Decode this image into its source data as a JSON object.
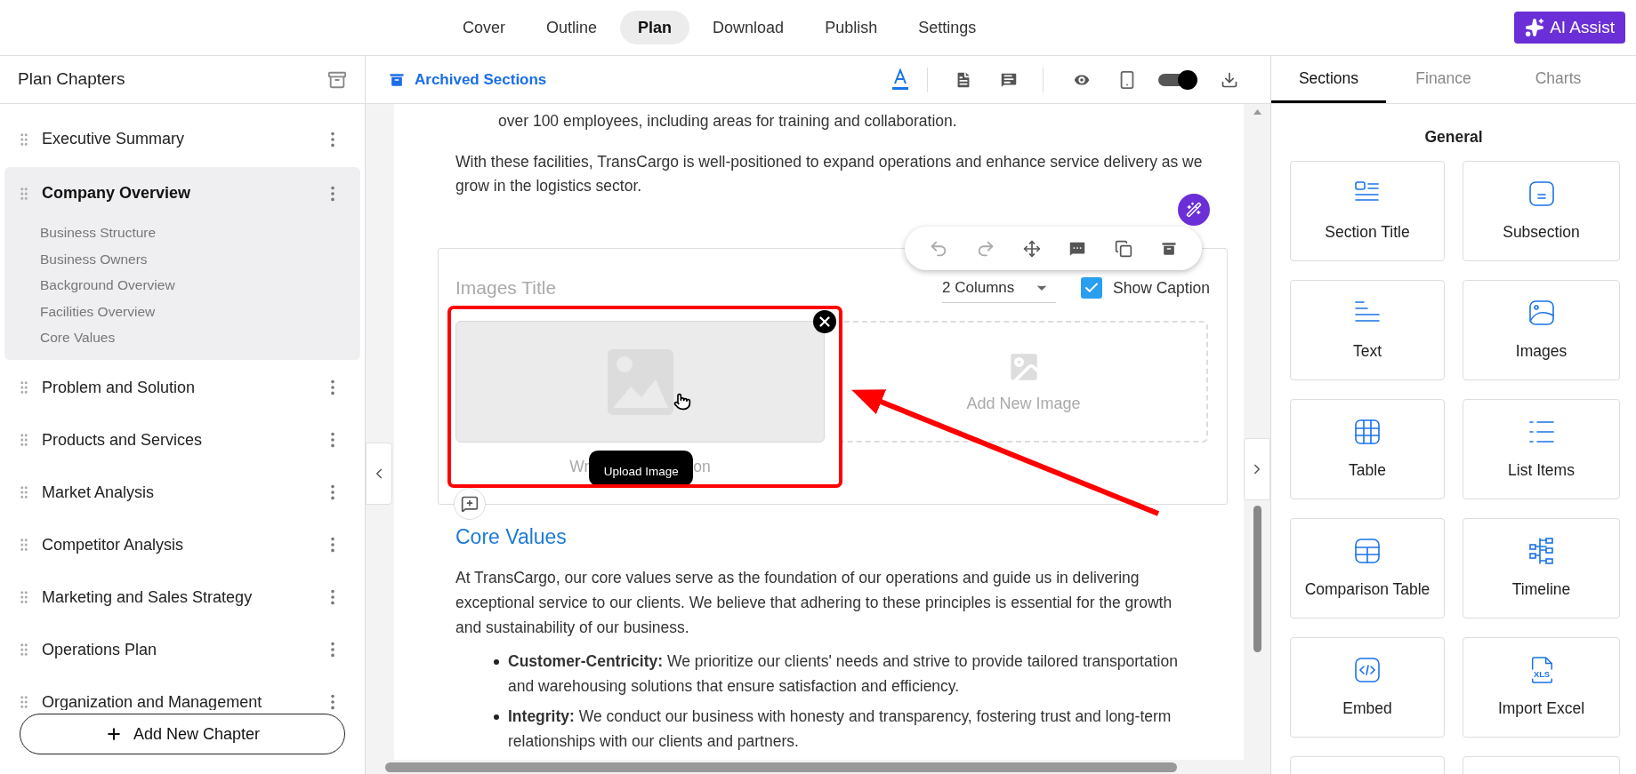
{
  "top_nav": {
    "tabs": [
      {
        "label": "Cover",
        "selected": false
      },
      {
        "label": "Outline",
        "selected": false
      },
      {
        "label": "Plan",
        "selected": true
      },
      {
        "label": "Download",
        "selected": false
      },
      {
        "label": "Publish",
        "selected": false
      },
      {
        "label": "Settings",
        "selected": false
      }
    ],
    "ai_button": "AI Assist"
  },
  "sidebar": {
    "title": "Plan Chapters",
    "chapters": [
      {
        "label": "Executive Summary",
        "selected": false,
        "expanded": false
      },
      {
        "label": "Company Overview",
        "selected": true,
        "expanded": true,
        "children": [
          {
            "label": "Business Structure"
          },
          {
            "label": "Business Owners"
          },
          {
            "label": "Background Overview"
          },
          {
            "label": "Facilities Overview"
          },
          {
            "label": "Core Values"
          }
        ]
      },
      {
        "label": "Problem and Solution",
        "selected": false,
        "expanded": false
      },
      {
        "label": "Products and Services",
        "selected": false,
        "expanded": false
      },
      {
        "label": "Market Analysis",
        "selected": false,
        "expanded": false
      },
      {
        "label": "Competitor Analysis",
        "selected": false,
        "expanded": false
      },
      {
        "label": "Marketing and Sales Strategy",
        "selected": false,
        "expanded": false
      },
      {
        "label": "Operations Plan",
        "selected": false,
        "expanded": false
      },
      {
        "label": "Organization and Management",
        "selected": false,
        "expanded": false
      }
    ],
    "add_button": "Add New Chapter"
  },
  "editor_toolbar": {
    "archived_link": "Archived Sections",
    "preview_toggle": {
      "on": true
    }
  },
  "document": {
    "intro_line": "over 100 employees, including areas for training and collaboration.",
    "paragraph": "With these facilities, TransCargo is well-positioned to expand operations and enhance service delivery as we grow in the logistics sector.",
    "image_block": {
      "title_placeholder": "Images Title",
      "columns": "2 Columns",
      "show_caption": {
        "label": "Show Caption",
        "checked": true
      },
      "images": [
        {
          "kind": "filled"
        },
        {
          "kind": "empty",
          "label": "Add New Image"
        }
      ],
      "caption_start": "Wr",
      "caption_end": "on",
      "tooltip": "Upload Image"
    },
    "heading": "Core Values",
    "body": "At TransCargo, our core values serve as the foundation of our operations and guide us in delivering exceptional service to our clients. We believe that adhering to these principles is essential for the growth and sustainability of our business.",
    "bullets": [
      {
        "text": "**Customer-Centricity:** We prioritize our clients' needs and strive to provide tailored transportation and warehousing solutions that ensure satisfaction and efficiency."
      },
      {
        "text": "**Integrity:** We conduct our business with honesty and transparency, fostering trust and long-term relationships with our clients and partners."
      }
    ]
  },
  "right_panel": {
    "tabs": [
      {
        "label": "Sections",
        "selected": true
      },
      {
        "label": "Finance",
        "selected": false
      },
      {
        "label": "Charts",
        "selected": false
      }
    ],
    "group_title": "General",
    "cards": [
      {
        "label": "Section Title",
        "kind": "section-title"
      },
      {
        "label": "Subsection",
        "kind": "subsection"
      },
      {
        "label": "Text",
        "kind": "text"
      },
      {
        "label": "Images",
        "kind": "images"
      },
      {
        "label": "Table",
        "kind": "table"
      },
      {
        "label": "List Items",
        "kind": "list"
      },
      {
        "label": "Comparison Table",
        "kind": "comparison"
      },
      {
        "label": "Timeline",
        "kind": "timeline"
      },
      {
        "label": "Embed",
        "kind": "embed"
      },
      {
        "label": "Import Excel",
        "kind": "excel"
      }
    ],
    "excel_icon_text": "XLS"
  }
}
